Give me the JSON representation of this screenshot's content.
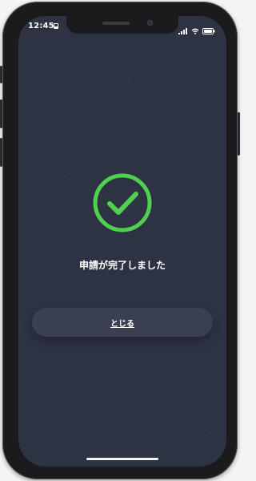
{
  "status_bar": {
    "time": "12:45",
    "icons": [
      "notification-icon",
      "signal-icon",
      "wifi-icon",
      "battery-icon"
    ]
  },
  "content": {
    "success_icon": "check-circle-icon",
    "message": "申請が完了しました",
    "close_label": "とじる"
  },
  "colors": {
    "background": "#2e3344",
    "accent": "#4fd14f",
    "button": "#3a3f51",
    "text": "#ffffff"
  }
}
